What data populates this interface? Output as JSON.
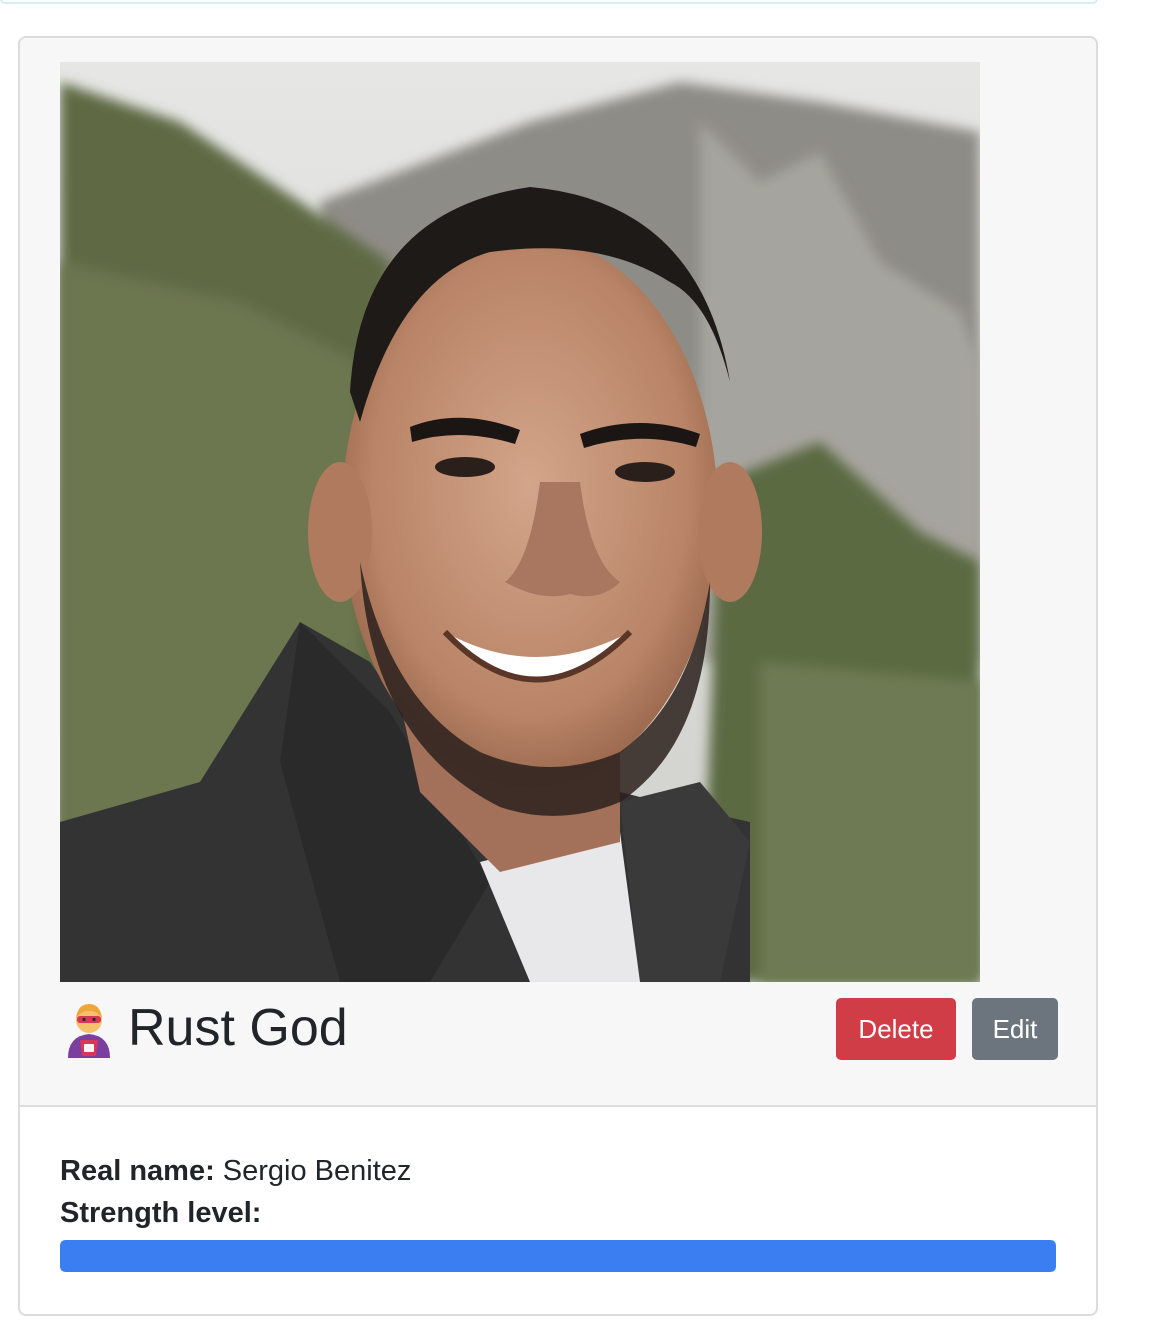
{
  "hero": {
    "name": "Rust God",
    "icon": "superhero-icon",
    "photo_alt": "Portrait of a smiling man on a hillside"
  },
  "actions": {
    "delete_label": "Delete",
    "edit_label": "Edit"
  },
  "details": {
    "real_name_label": "Real name:",
    "real_name_value": "Sergio Benitez",
    "strength_label": "Strength level:",
    "strength_fraction": 1.0
  },
  "colors": {
    "delete": "#d03d47",
    "edit": "#6c757d",
    "progress": "#3a7ef2"
  }
}
